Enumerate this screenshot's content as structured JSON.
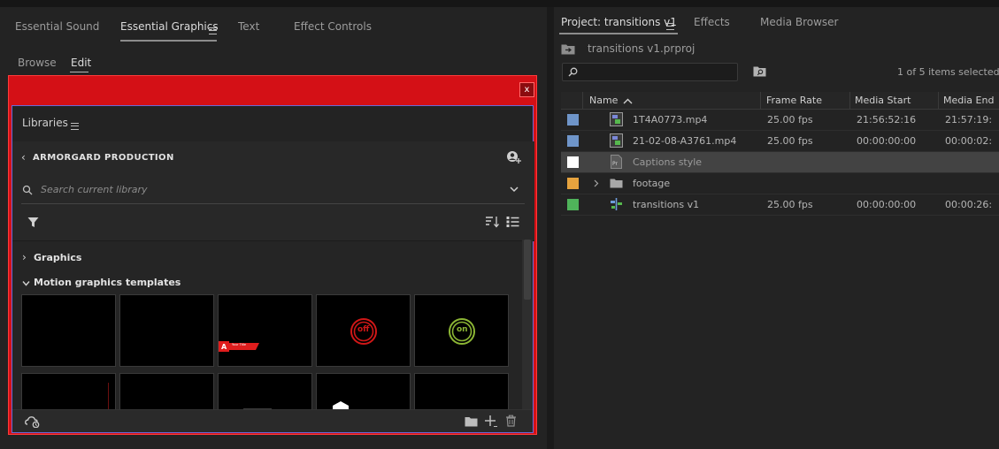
{
  "left": {
    "tabs": [
      {
        "label": "Essential Sound",
        "active": false
      },
      {
        "label": "Essential Graphics",
        "active": true
      },
      {
        "label": "Text",
        "active": false
      },
      {
        "label": "Effect Controls",
        "active": false
      }
    ],
    "subtabs": [
      {
        "label": "Browse",
        "active": false
      },
      {
        "label": "Edit",
        "active": true
      }
    ],
    "dialog": {
      "close_glyph": "x",
      "libraries_title": "Libraries",
      "library_name": "ARMORGARD PRODUCTION",
      "search_placeholder": "Search current library",
      "sections": [
        {
          "label": "Graphics",
          "expanded": false
        },
        {
          "label": "Motion graphics templates",
          "expanded": true
        }
      ],
      "thumbnails": [
        {
          "name": "",
          "content": "blank"
        },
        {
          "name": "",
          "content": "blank"
        },
        {
          "name": "",
          "content": "lower-third"
        },
        {
          "name": "off",
          "content": "off-badge"
        },
        {
          "name": "on",
          "content": "on-badge"
        },
        {
          "name": "",
          "content": "partial-line"
        },
        {
          "name": "",
          "content": "blank"
        },
        {
          "name": "",
          "content": "partial-dash"
        },
        {
          "name": "",
          "content": "partial-house"
        },
        {
          "name": "",
          "content": "blank"
        }
      ],
      "lower_third_text": "Your Title",
      "off_text": "off",
      "on_text": "on"
    }
  },
  "right": {
    "tabs": [
      {
        "label": "Project: transitions v1",
        "active": true
      },
      {
        "label": "Effects",
        "active": false
      },
      {
        "label": "Media Browser",
        "active": false
      }
    ],
    "project_file": "transitions v1.prproj",
    "selection_status": "1 of 5 items selected",
    "columns": [
      "Name",
      "Frame Rate",
      "Media Start",
      "Media End"
    ],
    "rows": [
      {
        "color": "#6f95c9",
        "icon": "video-clip-icon",
        "name": "1T4A0773.mp4",
        "frame_rate": "25.00 fps",
        "media_start": "21:56:52:16",
        "media_end": "21:57:19:",
        "selected": false
      },
      {
        "color": "#6f95c9",
        "icon": "video-clip-icon",
        "name": "21-02-08-A3761.mp4",
        "frame_rate": "25.00 fps",
        "media_start": "00:00:00:00",
        "media_end": "00:00:02:",
        "selected": false
      },
      {
        "color": "#ffffff",
        "icon": "captions-icon",
        "name": "Captions style",
        "frame_rate": "",
        "media_start": "",
        "media_end": "",
        "selected": true
      },
      {
        "color": "#e6a33e",
        "icon": "folder-icon",
        "name": "footage",
        "frame_rate": "",
        "media_start": "",
        "media_end": "",
        "selected": false
      },
      {
        "color": "#4fb35a",
        "icon": "sequence-icon",
        "name": "transitions v1",
        "frame_rate": "25.00 fps",
        "media_start": "00:00:00:00",
        "media_end": "00:00:26:",
        "selected": false
      }
    ]
  }
}
